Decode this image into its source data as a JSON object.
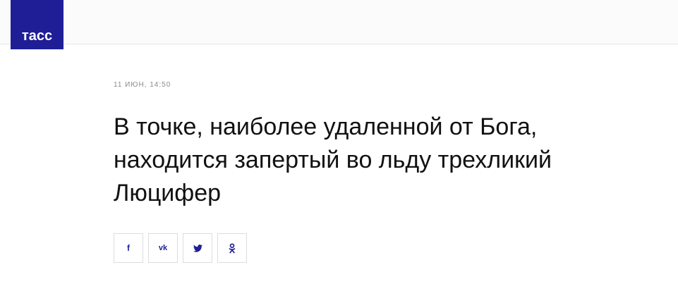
{
  "header": {
    "logo_text": "тасс"
  },
  "article": {
    "date": "11 ИЮН, 14:50",
    "headline": "В точке, наиболее удаленной от Бога, находится запертый во льду трехликий Люцифер"
  },
  "share": {
    "buttons": [
      {
        "name": "facebook",
        "glyph": "f"
      },
      {
        "name": "vk",
        "glyph": "vk"
      },
      {
        "name": "twitter",
        "glyph": ""
      },
      {
        "name": "odnoklassniki",
        "glyph": ""
      }
    ]
  },
  "colors": {
    "brand": "#1f1e96"
  }
}
